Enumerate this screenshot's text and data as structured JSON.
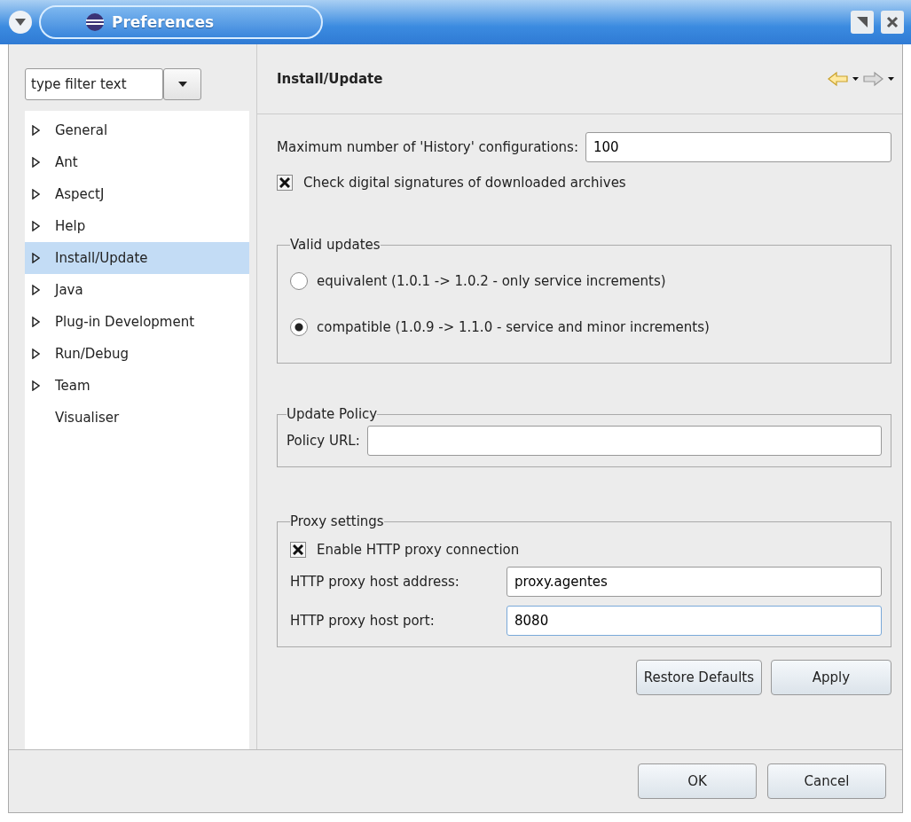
{
  "window": {
    "title": "Preferences"
  },
  "filter": {
    "placeholder": "type filter text"
  },
  "tree": [
    {
      "label": "General",
      "expandable": true,
      "selected": false
    },
    {
      "label": "Ant",
      "expandable": true,
      "selected": false
    },
    {
      "label": "AspectJ",
      "expandable": true,
      "selected": false
    },
    {
      "label": "Help",
      "expandable": true,
      "selected": false
    },
    {
      "label": "Install/Update",
      "expandable": true,
      "selected": true
    },
    {
      "label": "Java",
      "expandable": true,
      "selected": false
    },
    {
      "label": "Plug-in Development",
      "expandable": true,
      "selected": false
    },
    {
      "label": "Run/Debug",
      "expandable": true,
      "selected": false
    },
    {
      "label": "Team",
      "expandable": true,
      "selected": false
    },
    {
      "label": "Visualiser",
      "expandable": false,
      "selected": false
    }
  ],
  "page": {
    "title": "Install/Update"
  },
  "history": {
    "label": "Maximum number of 'History' configurations:",
    "value": "100"
  },
  "check_signatures": {
    "label": "Check digital signatures of downloaded archives",
    "checked": true
  },
  "valid_updates": {
    "title": "Valid updates",
    "options": [
      {
        "label": "equivalent (1.0.1 -> 1.0.2 - only service increments)",
        "selected": false
      },
      {
        "label": "compatible (1.0.9 -> 1.1.0 - service and minor increments)",
        "selected": true
      }
    ]
  },
  "update_policy": {
    "title": "Update Policy",
    "url_label": "Policy URL:"
  },
  "proxy": {
    "title": "Proxy settings",
    "enable": {
      "label": "Enable HTTP proxy connection",
      "checked": true
    },
    "fields": [
      {
        "label": "HTTP proxy host address:",
        "value": "proxy.agentes",
        "focused": false
      },
      {
        "label": "HTTP proxy host port:",
        "value": "8080",
        "focused": true
      }
    ]
  },
  "page_buttons": [
    "Restore Defaults",
    "Apply"
  ],
  "dialog_buttons": [
    "OK",
    "Cancel"
  ]
}
